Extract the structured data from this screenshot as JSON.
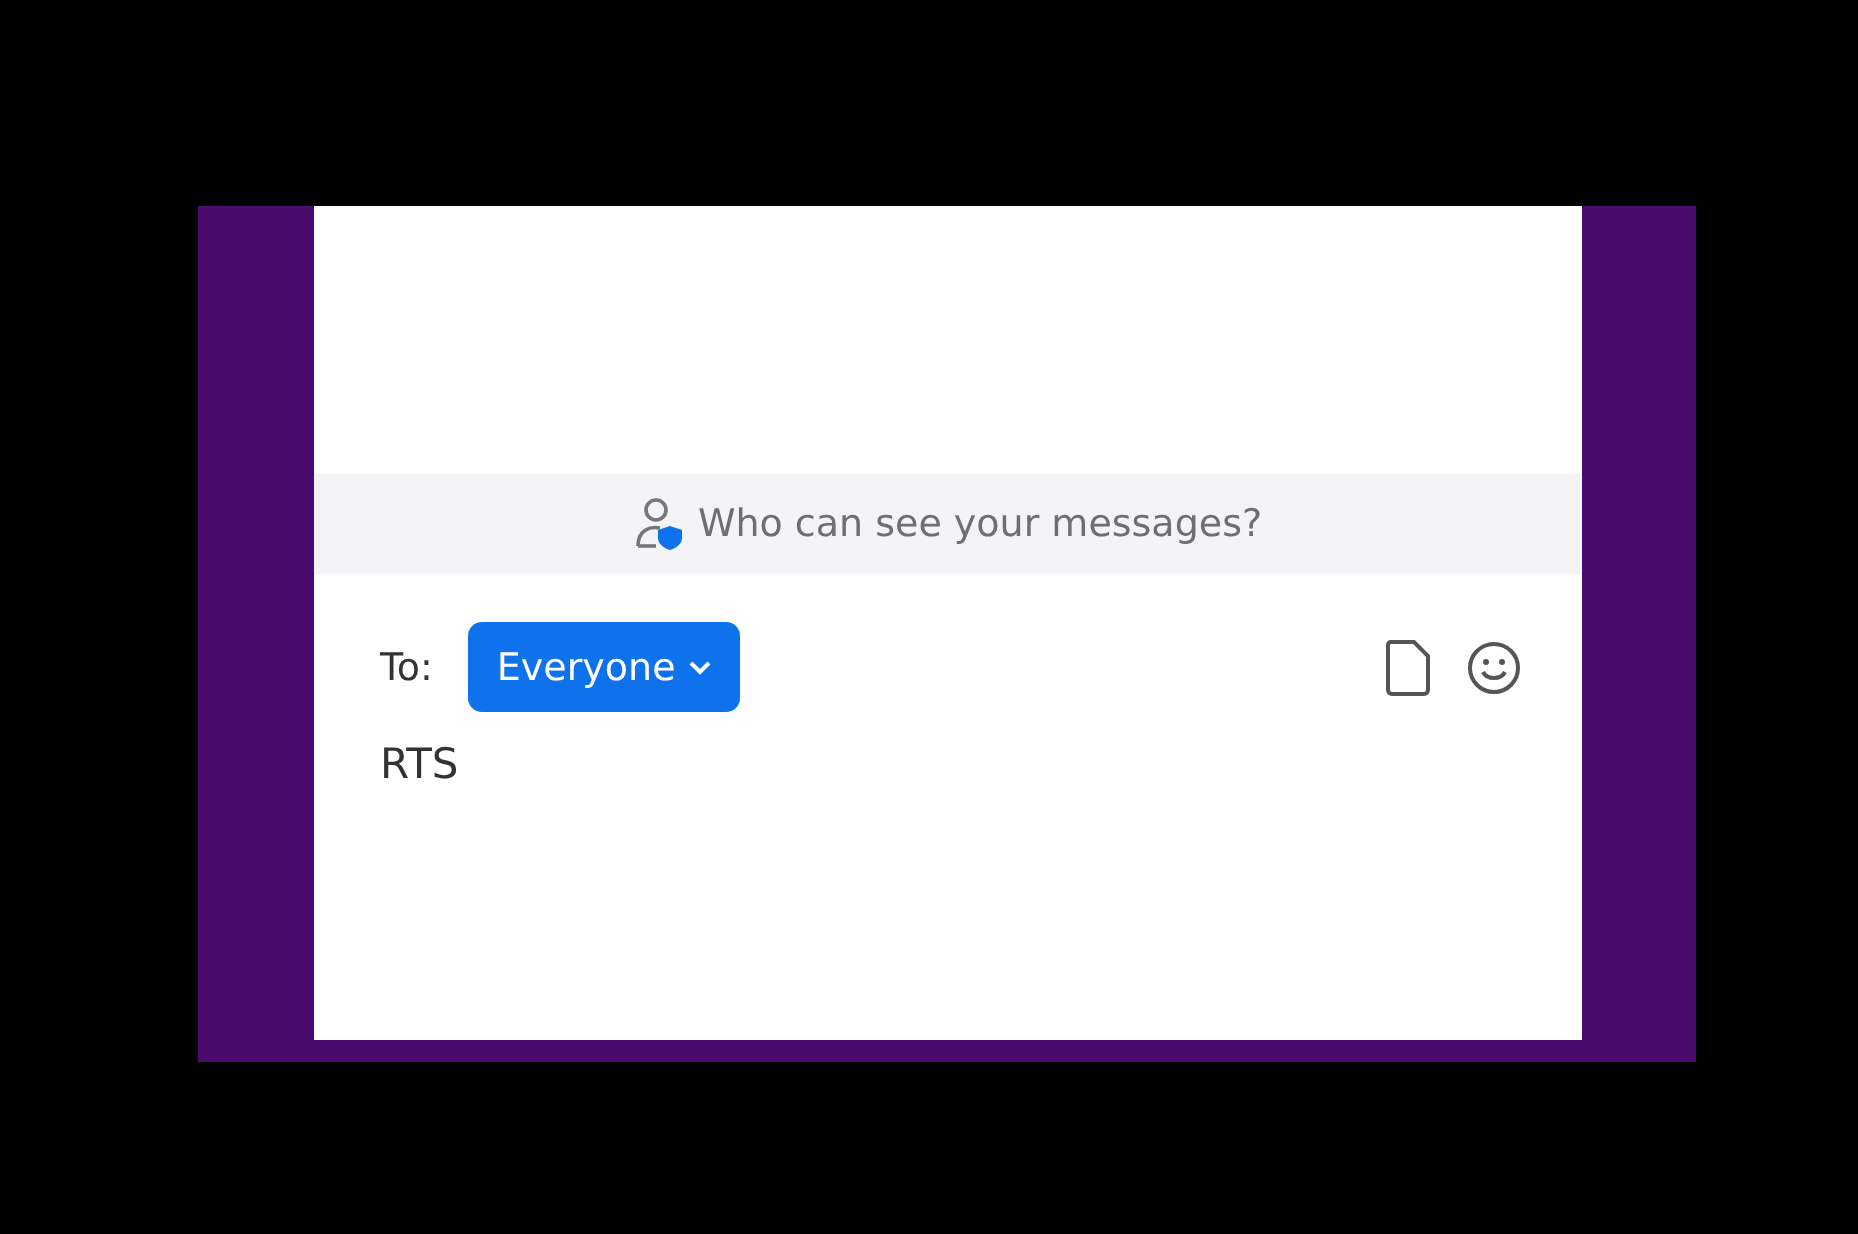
{
  "privacy_banner": {
    "text": "Who can see your messages?"
  },
  "compose": {
    "to_label": "To:",
    "recipient": "Everyone",
    "message": "RTS"
  }
}
